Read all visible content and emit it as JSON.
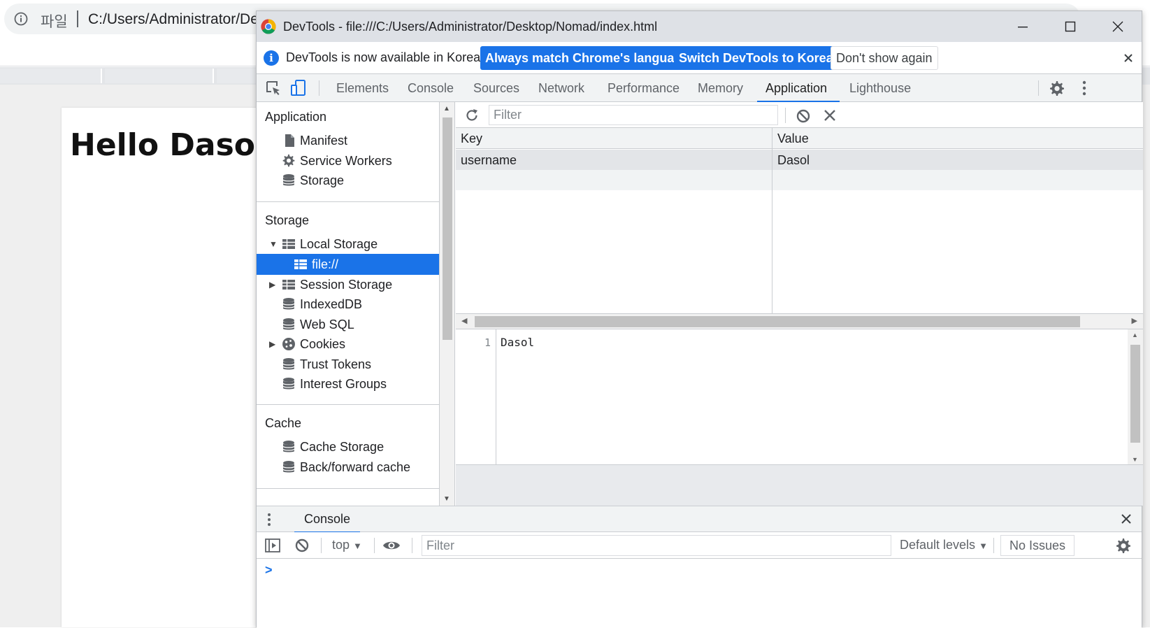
{
  "browser": {
    "address_scheme": "파일",
    "address_url": "C:/Users/Administrator/De",
    "page_heading": "Hello Dasol"
  },
  "devtools": {
    "window_title": "DevTools - file:///C:/Users/Administrator/Desktop/Nomad/index.html",
    "infobar": {
      "message": "DevTools is now available in Korean!",
      "btn_match": "Always match Chrome's language",
      "btn_switch": "Switch DevTools to Korean",
      "btn_dont_show": "Don't show again"
    },
    "tabs": [
      "Elements",
      "Console",
      "Sources",
      "Network",
      "Performance",
      "Memory",
      "Application",
      "Lighthouse"
    ],
    "active_tab": "Application",
    "sidebar": {
      "section_application": "Application",
      "application_items": [
        "Manifest",
        "Service Workers",
        "Storage"
      ],
      "section_storage": "Storage",
      "storage_items": {
        "local_storage": "Local Storage",
        "local_storage_origin": "file://",
        "session_storage": "Session Storage",
        "indexeddb": "IndexedDB",
        "web_sql": "Web SQL",
        "cookies": "Cookies",
        "trust_tokens": "Trust Tokens",
        "interest_groups": "Interest Groups"
      },
      "section_cache": "Cache",
      "cache_items": [
        "Cache Storage",
        "Back/forward cache"
      ]
    },
    "storage_panel": {
      "filter_placeholder": "Filter",
      "columns": [
        "Key",
        "Value"
      ],
      "rows": [
        {
          "key": "username",
          "value": "Dasol"
        }
      ],
      "preview_line_number": "1",
      "preview_text": "Dasol"
    },
    "drawer": {
      "tab_label": "Console",
      "context": "top",
      "filter_placeholder": "Filter",
      "levels": "Default levels",
      "issues": "No Issues",
      "prompt": ">"
    }
  },
  "colors": {
    "accent": "#1a73e8",
    "titlebar": "#dee1e6",
    "panel_bg": "#f1f3f4"
  }
}
